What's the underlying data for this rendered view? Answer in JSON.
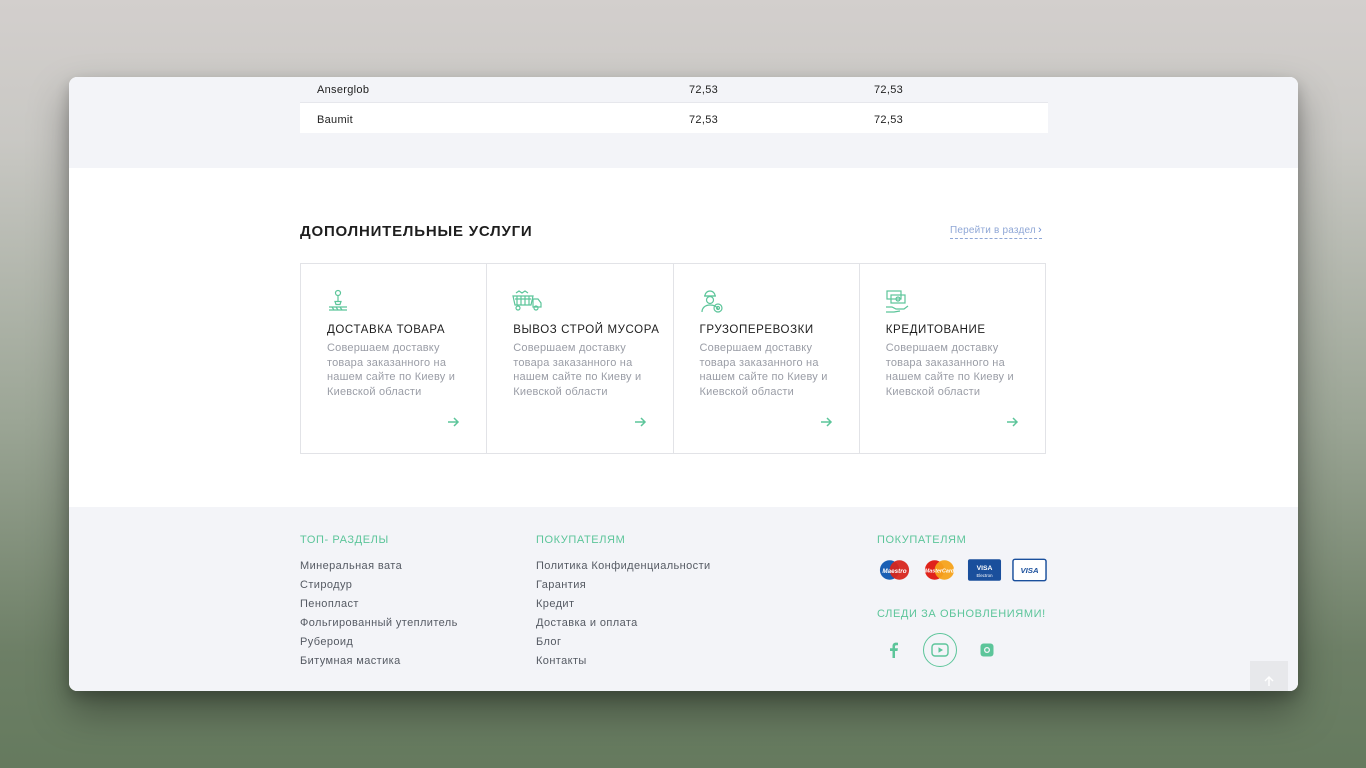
{
  "table": {
    "rows": [
      {
        "name": "Anserglob",
        "v1": "72,53",
        "v2": "72,53"
      },
      {
        "name": "Baumit",
        "v1": "72,53",
        "v2": "72,53"
      }
    ]
  },
  "services": {
    "title": "ДОПОЛНИТЕЛЬНЫЕ УСЛУГИ",
    "goto_label": "Перейти в раздел",
    "cards": [
      {
        "title": "ДОСТАВКА ТОВАРА",
        "desc": "Совершаем доставку товара заказанного на нашем сайте по Киеву и Киевской области",
        "icon": "crane-hook-icon"
      },
      {
        "title": "ВЫВОЗ СТРОЙ МУСОРА",
        "desc": "Совершаем доставку товара заказанного на нашем сайте по Киеву и Киевской области",
        "icon": "dump-truck-icon"
      },
      {
        "title": "ГРУЗОПЕРЕВОЗКИ",
        "desc": "Совершаем доставку товара заказанного на нашем сайте по Киеву и Киевской области",
        "icon": "worker-icon"
      },
      {
        "title": "КРЕДИТОВАНИЕ",
        "desc": "Совершаем доставку товара заказанного на нашем сайте по Киеву и Киевской области",
        "icon": "money-hand-icon"
      }
    ]
  },
  "footer": {
    "col1": {
      "title": "ТОП- РАЗДЕЛЫ",
      "items": [
        "Минеральная вата",
        "Стиродур",
        "Пенопласт",
        "Фольгированный утеплитель",
        "Рубероид",
        "Битумная мастика"
      ]
    },
    "col2": {
      "title": "ПОКУПАТЕЛЯМ",
      "items": [
        "Политика Конфиденциальности",
        "Гарантия",
        "Кредит",
        "Доставка и оплата",
        "Блог",
        "Контакты"
      ]
    },
    "col3": {
      "title": "ПОКУПАТЕЛЯМ",
      "payments": [
        "Maestro",
        "MasterCard",
        "VISA Electron",
        "VISA"
      ],
      "follow_title": "СЛЕДИ ЗА ОБНОВЛЕНИЯМИ!",
      "social": [
        "facebook-icon",
        "youtube-icon",
        "instagram-icon"
      ]
    }
  },
  "colors": {
    "accent": "#5cc59a",
    "link": "#8fa7d6"
  }
}
